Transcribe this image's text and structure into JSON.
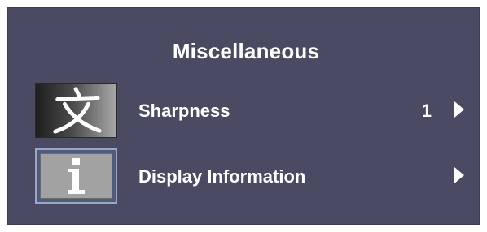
{
  "menu": {
    "title": "Miscellaneous",
    "items": [
      {
        "label": "Sharpness",
        "value": "1",
        "icon": "sharpness-character-icon"
      },
      {
        "label": "Display Information",
        "value": "",
        "icon": "info-icon"
      }
    ]
  },
  "colors": {
    "panel_background": "#4a4a62",
    "text": "#ffffff",
    "selected_icon_border": "#9aa6c6"
  }
}
